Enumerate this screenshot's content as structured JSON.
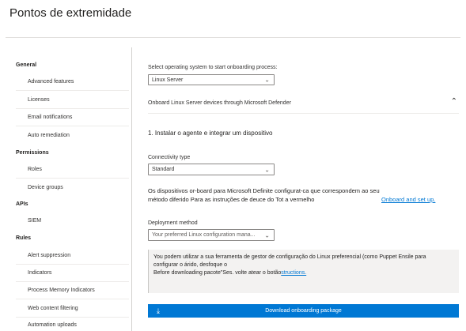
{
  "page": {
    "title": "Pontos de extremidade"
  },
  "sidebar": {
    "sections": [
      {
        "heading": "General",
        "items": [
          "Advanced features",
          "Licenses",
          "Email notifications",
          "Auto remediation"
        ]
      },
      {
        "heading": "Permissions",
        "items": [
          "Roles",
          "Device groups"
        ]
      },
      {
        "heading": "APIs",
        "items": [
          "SIEM"
        ]
      },
      {
        "heading": "Rules",
        "items": [
          "Alert suppression",
          "Indicators",
          "Process Memory Indicators",
          "Web content filtering",
          "Automation uploads"
        ]
      }
    ]
  },
  "main": {
    "os_label": "Select operating system to start onboarding process:",
    "os_value": "Linux Server",
    "section_title": "Onboard Linux Server devices through Microsoft Defender",
    "step1": "1. Instalar o agente e integrar um dispositivo",
    "connectivity_label": "Connectivity type",
    "connectivity_value": "Standard",
    "desc_line1": "Os dispositivos or-board para Microsoft Definite configurat-ca que correspondem ao seu",
    "desc_line2": "método diferido Para as instruções de deuce do Tot a vermelho",
    "onboard_link": "Onboard and set up.",
    "deployment_label": "Deployment method",
    "deployment_placeholder": "Your preferred Linux configuration mana...",
    "info_line1": "You podem utilizar a sua ferramenta de gestor de configuração do Linux preferencial (como Puppet Ensile para",
    "info_line2": "configurar o árido, desfoque o",
    "info_line3_prefix": "Before downloading pacote\"Ses. volte atear o botão",
    "info_link": "structions.",
    "download_label": "Download onboarding package"
  }
}
